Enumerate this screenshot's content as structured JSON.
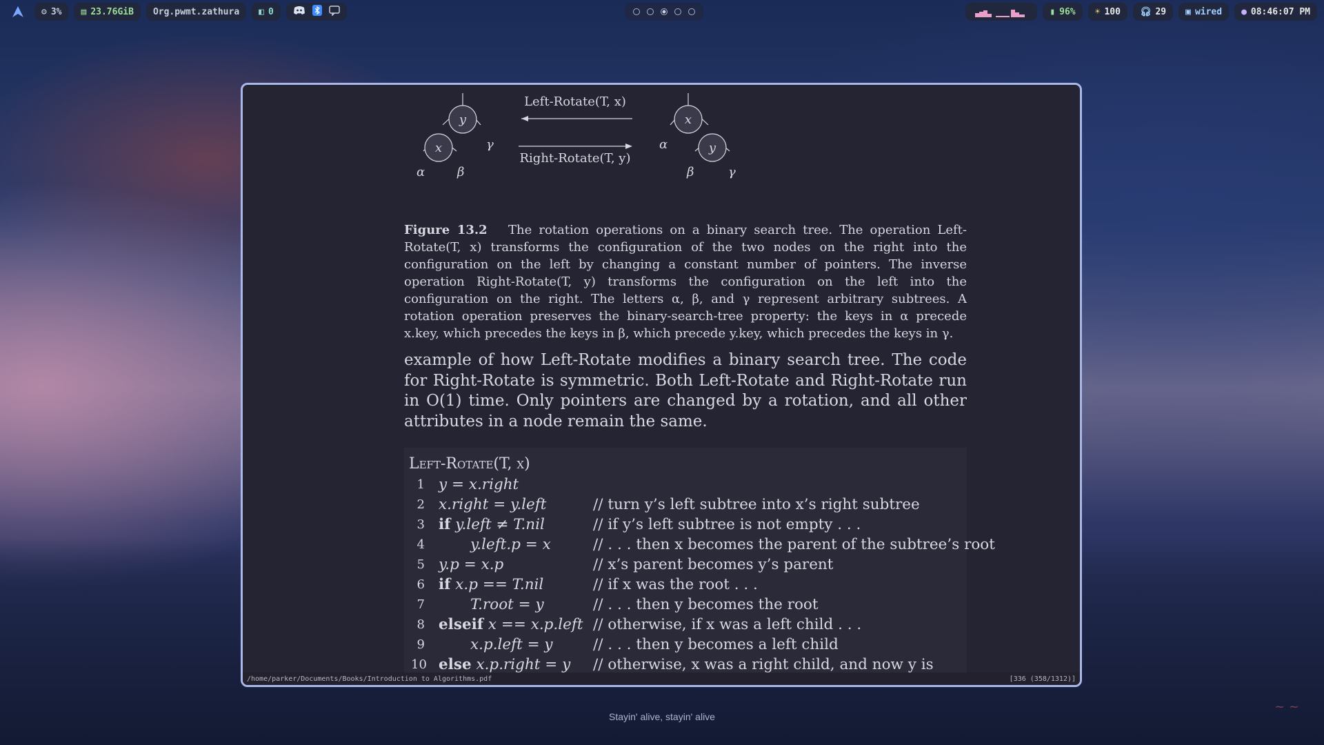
{
  "topbar": {
    "left": {
      "cpu": "3%",
      "memory": "23.76GiB",
      "window_class": "Org.pwmt.zathura",
      "counter": "0"
    },
    "workspaces": [
      {
        "active": false
      },
      {
        "active": false
      },
      {
        "active": true
      },
      {
        "active": false
      },
      {
        "active": false
      }
    ],
    "right": {
      "battery": "96%",
      "brightness": "100",
      "volume": "29",
      "network": "wired",
      "clock": "08:46:07 PM"
    }
  },
  "figure": {
    "left_rotate": "Left-Rotate(T, x)",
    "right_rotate": "Right-Rotate(T, y)",
    "left_tree": {
      "root": "y",
      "child": "x",
      "gamma": "γ",
      "alpha": "α",
      "beta": "β"
    },
    "right_tree": {
      "root": "x",
      "child": "y",
      "alpha": "α",
      "beta": "β",
      "gamma": "γ"
    }
  },
  "caption": {
    "label": "Figure 13.2",
    "text": "The rotation operations on a binary search tree. The operation Left-Rotate(T, x) transforms the configuration of the two nodes on the right into the configuration on the left by changing a constant number of pointers. The inverse operation Right-Rotate(T, y) transforms the configuration on the left into the configuration on the right. The letters α, β, and γ represent arbitrary subtrees. A rotation operation preserves the binary-search-tree property: the keys in α precede x.key, which precedes the keys in β, which precede y.key, which precedes the keys in γ."
  },
  "paragraph": "example of how Left-Rotate modifies a binary search tree. The code for Right-Rotate is symmetric. Both Left-Rotate and Right-Rotate run in O(1) time. Only pointers are changed by a rotation, and all other attributes in a node remain the same.",
  "code": {
    "title": "Left-Rotate(T, x)",
    "lines": [
      {
        "n": "1",
        "stmt": "y = x.right",
        "comment": ""
      },
      {
        "n": "2",
        "stmt": "x.right = y.left",
        "comment": "// turn y’s left subtree into x’s right subtree"
      },
      {
        "n": "3",
        "stmt": "if y.left ≠ T.nil",
        "comment": "// if y’s left subtree is not empty . . ."
      },
      {
        "n": "4",
        "stmt": "y.left.p = x",
        "comment": "// . . . then x becomes the parent of the subtree’s root"
      },
      {
        "n": "5",
        "stmt": "y.p = x.p",
        "comment": "// x’s parent becomes y’s parent"
      },
      {
        "n": "6",
        "stmt": "if x.p == T.nil",
        "comment": "// if x was the root . . ."
      },
      {
        "n": "7",
        "stmt": "T.root = y",
        "comment": "// . . . then y becomes the root"
      },
      {
        "n": "8",
        "stmt": "elseif x == x.p.left",
        "comment": "// otherwise, if x was a left child . . ."
      },
      {
        "n": "9",
        "stmt": "x.p.left = y",
        "comment": "// . . . then y becomes a left child"
      },
      {
        "n": "10",
        "stmt": "else x.p.right = y",
        "comment": "// otherwise, x was a right child, and now y is"
      }
    ]
  },
  "statusbar": {
    "path": "/home/parker/Documents/Books/Introduction to Algorithms.pdf",
    "page_info": "[336 (358/1312)]"
  },
  "tagline": "Stayin' alive, stayin' alive",
  "colors": {
    "window_border": "#a9b8e8",
    "page_bg": "#252433",
    "text": "#d9d7e0",
    "node_fill": "#3b3a4a"
  }
}
